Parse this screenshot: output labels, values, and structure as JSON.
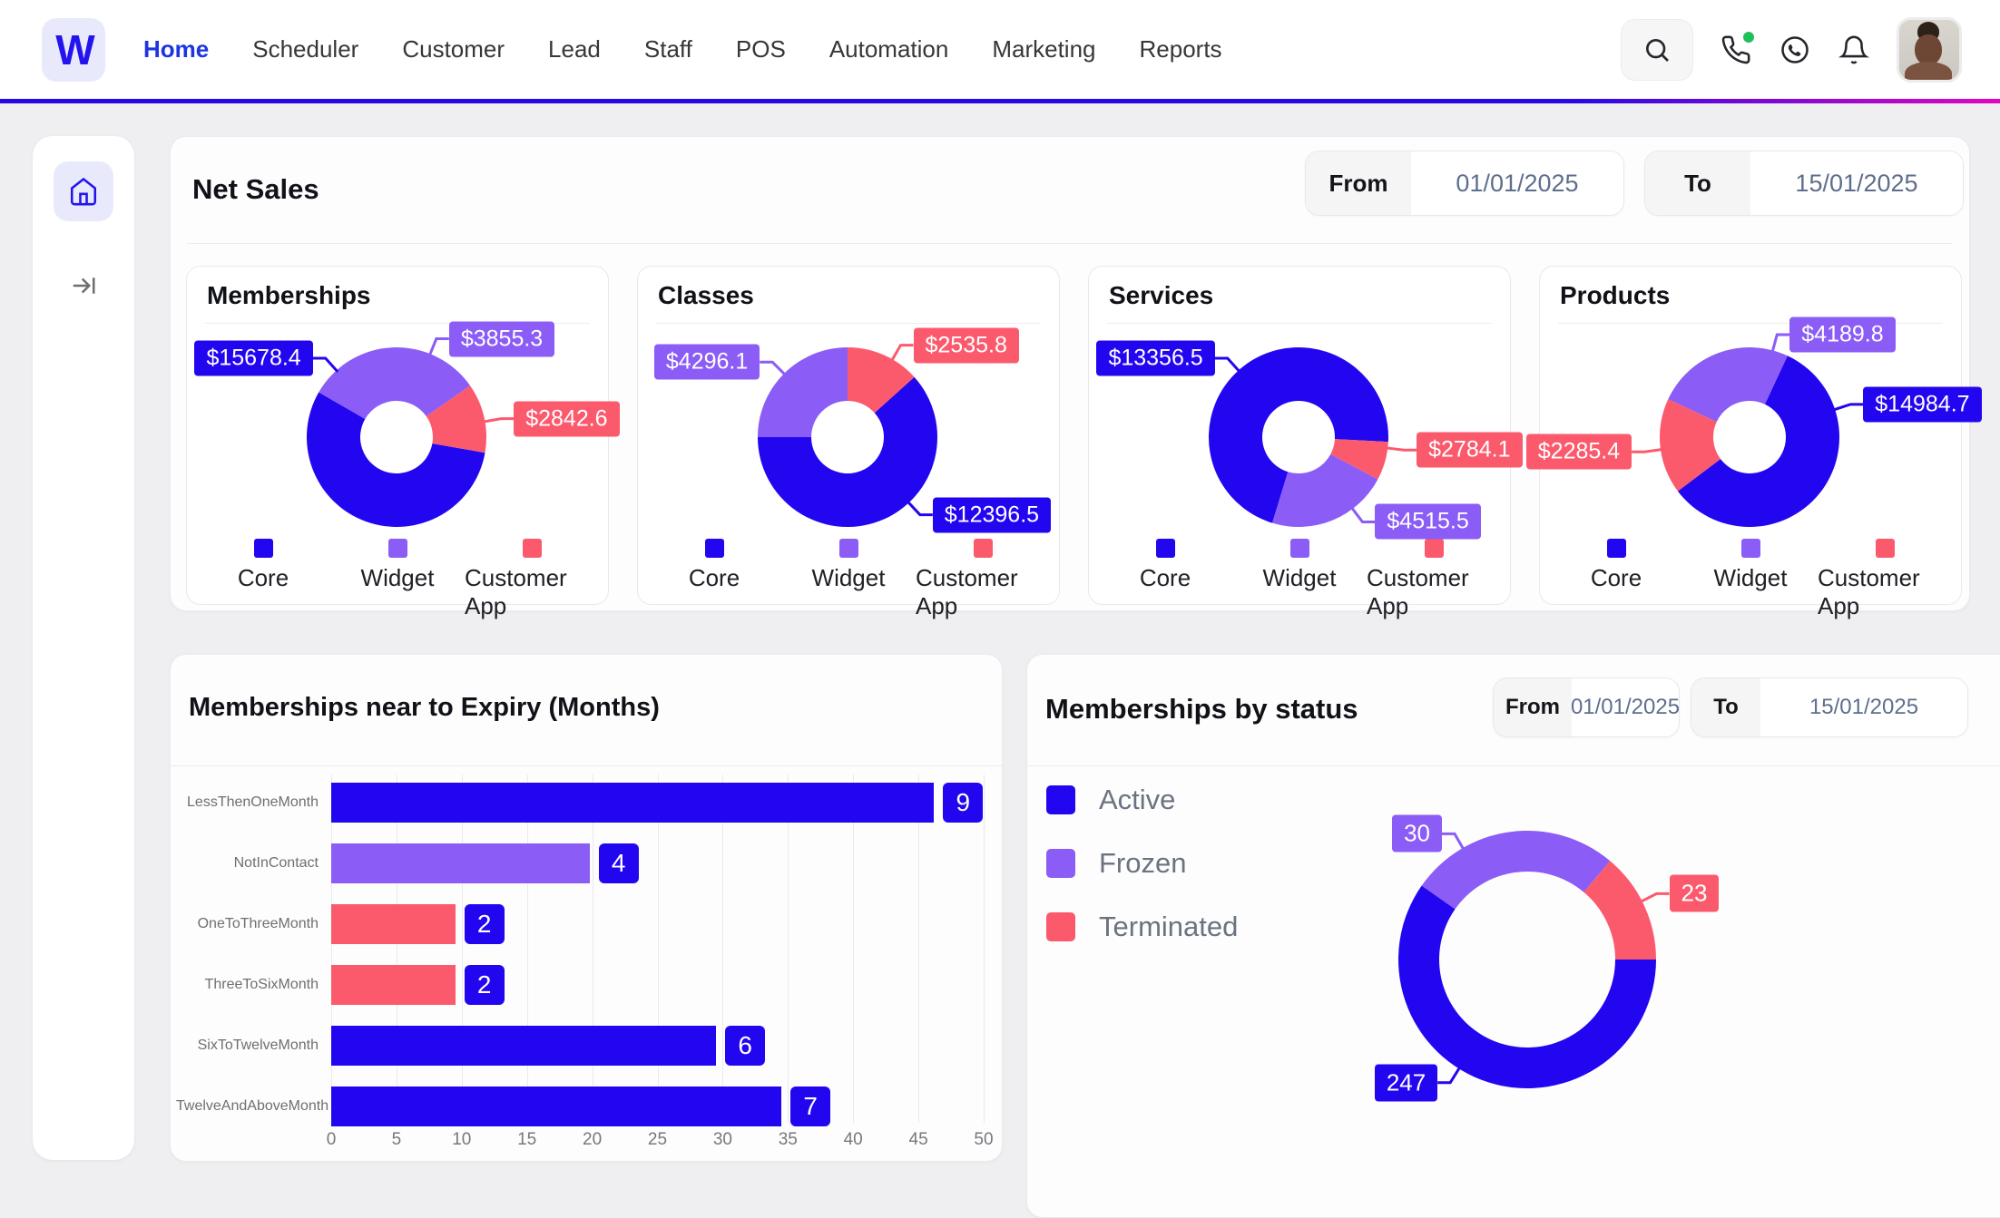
{
  "colors": {
    "core": "#2306f0",
    "widget": "#8b5cf6",
    "customer_app": "#fb5a6d",
    "nav_active": "#1c35e2",
    "gradient_start": "#2209e6",
    "gradient_end": "#e207c1",
    "green_dot": "#1fc05a"
  },
  "nav": {
    "logo_text": "W",
    "items": [
      {
        "label": "Home",
        "active": true
      },
      {
        "label": "Scheduler",
        "active": false
      },
      {
        "label": "Customer",
        "active": false
      },
      {
        "label": "Lead",
        "active": false
      },
      {
        "label": "Staff",
        "active": false
      },
      {
        "label": "POS",
        "active": false
      },
      {
        "label": "Automation",
        "active": false
      },
      {
        "label": "Marketing",
        "active": false
      },
      {
        "label": "Reports",
        "active": false
      }
    ],
    "icons": [
      "search-icon",
      "phone-icon",
      "whatsapp-icon",
      "bell-icon",
      "avatar"
    ]
  },
  "sidebar": {
    "icons": [
      "home-icon",
      "collapse-icon"
    ]
  },
  "net_sales": {
    "title": "Net Sales",
    "date_from": {
      "label": "From",
      "value": "01/01/2025"
    },
    "date_to": {
      "label": "To",
      "value": "15/01/2025"
    },
    "legend": [
      {
        "label": "Core",
        "color": "core"
      },
      {
        "label": "Widget",
        "color": "widget"
      },
      {
        "label": "Customer App",
        "color": "customer_app"
      }
    ],
    "donuts": [
      {
        "title": "Memberships",
        "slices": [
          {
            "name": "Core",
            "value": 15678.4,
            "label": "$15678.4",
            "color": "core",
            "start": 100,
            "span": 200,
            "label_angle": 318
          },
          {
            "name": "Widget",
            "value": 3855.3,
            "label": "$3855.3",
            "color": "widget",
            "start": 300,
            "span": 115,
            "label_angle": 22
          },
          {
            "name": "Customer App",
            "value": 2842.6,
            "label": "$2842.6",
            "color": "customer_app",
            "start": 55,
            "span": 45,
            "label_angle": 80
          }
        ]
      },
      {
        "title": "Classes",
        "slices": [
          {
            "name": "Core",
            "value": 12396.5,
            "label": "$12396.5",
            "color": "core",
            "start": 48,
            "span": 222,
            "label_angle": 137
          },
          {
            "name": "Widget",
            "value": 4296.1,
            "label": "$4296.1",
            "color": "widget",
            "start": 270,
            "span": 90,
            "label_angle": 315
          },
          {
            "name": "Customer App",
            "value": 2535.8,
            "label": "$2535.8",
            "color": "customer_app",
            "start": 0,
            "span": 48,
            "label_angle": 30
          }
        ]
      },
      {
        "title": "Services",
        "slices": [
          {
            "name": "Core",
            "value": 13356.5,
            "label": "$13356.5",
            "color": "core",
            "start": 197,
            "span": 256,
            "label_angle": 318
          },
          {
            "name": "Widget",
            "value": 4515.5,
            "label": "$4515.5",
            "color": "widget",
            "start": 118,
            "span": 79,
            "label_angle": 143
          },
          {
            "name": "Customer App",
            "value": 2784.1,
            "label": "$2784.1",
            "color": "customer_app",
            "start": 93,
            "span": 25,
            "label_angle": 97
          }
        ]
      },
      {
        "title": "Products",
        "slices": [
          {
            "name": "Core",
            "value": 14984.7,
            "label": "$14984.7",
            "color": "core",
            "start": 25,
            "span": 208,
            "label_angle": 72
          },
          {
            "name": "Widget",
            "value": 4189.8,
            "label": "$4189.8",
            "color": "widget",
            "start": 295,
            "span": 90,
            "label_angle": 15
          },
          {
            "name": "Customer App",
            "value": 2285.4,
            "label": "$2285.4",
            "color": "customer_app",
            "start": 233,
            "span": 62,
            "label_angle": 262
          }
        ]
      }
    ]
  },
  "expiry_chart": {
    "type": "bar",
    "title": "Memberships near to Expiry (Months)",
    "categories": [
      "LessThenOneMonth",
      "NotInContact",
      "OneToThreeMonth",
      "ThreeToSixMonth",
      "SixToTwelveMonth",
      "TwelveAndAboveMonth"
    ],
    "values": [
      9,
      4,
      2,
      2,
      6,
      7
    ],
    "bar_axis_units": [
      46.2,
      19.8,
      9.5,
      9.5,
      29.5,
      34.5
    ],
    "bar_colors": [
      "core",
      "widget",
      "customer_app",
      "customer_app",
      "core",
      "core"
    ],
    "x_ticks": [
      "0",
      "5",
      "10",
      "15",
      "20",
      "25",
      "30",
      "35",
      "40",
      "45",
      "50"
    ],
    "xlim": [
      0,
      50
    ],
    "grid": true
  },
  "status_chart": {
    "type": "pie",
    "title": "Memberships by status",
    "date_from": {
      "label": "From",
      "value": "01/01/2025"
    },
    "date_to": {
      "label": "To",
      "value": "15/01/2025"
    },
    "legend": [
      {
        "label": "Active",
        "color": "core"
      },
      {
        "label": "Frozen",
        "color": "widget"
      },
      {
        "label": "Terminated",
        "color": "customer_app"
      }
    ],
    "slices": [
      {
        "name": "Active",
        "value": 247,
        "label": "247",
        "color": "core",
        "start": 90,
        "span": 215,
        "label_angle": 212
      },
      {
        "name": "Frozen",
        "value": 30,
        "label": "30",
        "color": "widget",
        "start": 305,
        "span": 95,
        "label_angle": 330
      },
      {
        "name": "Terminated",
        "value": 23,
        "label": "23",
        "color": "customer_app",
        "start": 40,
        "span": 50,
        "label_angle": 63
      }
    ]
  }
}
